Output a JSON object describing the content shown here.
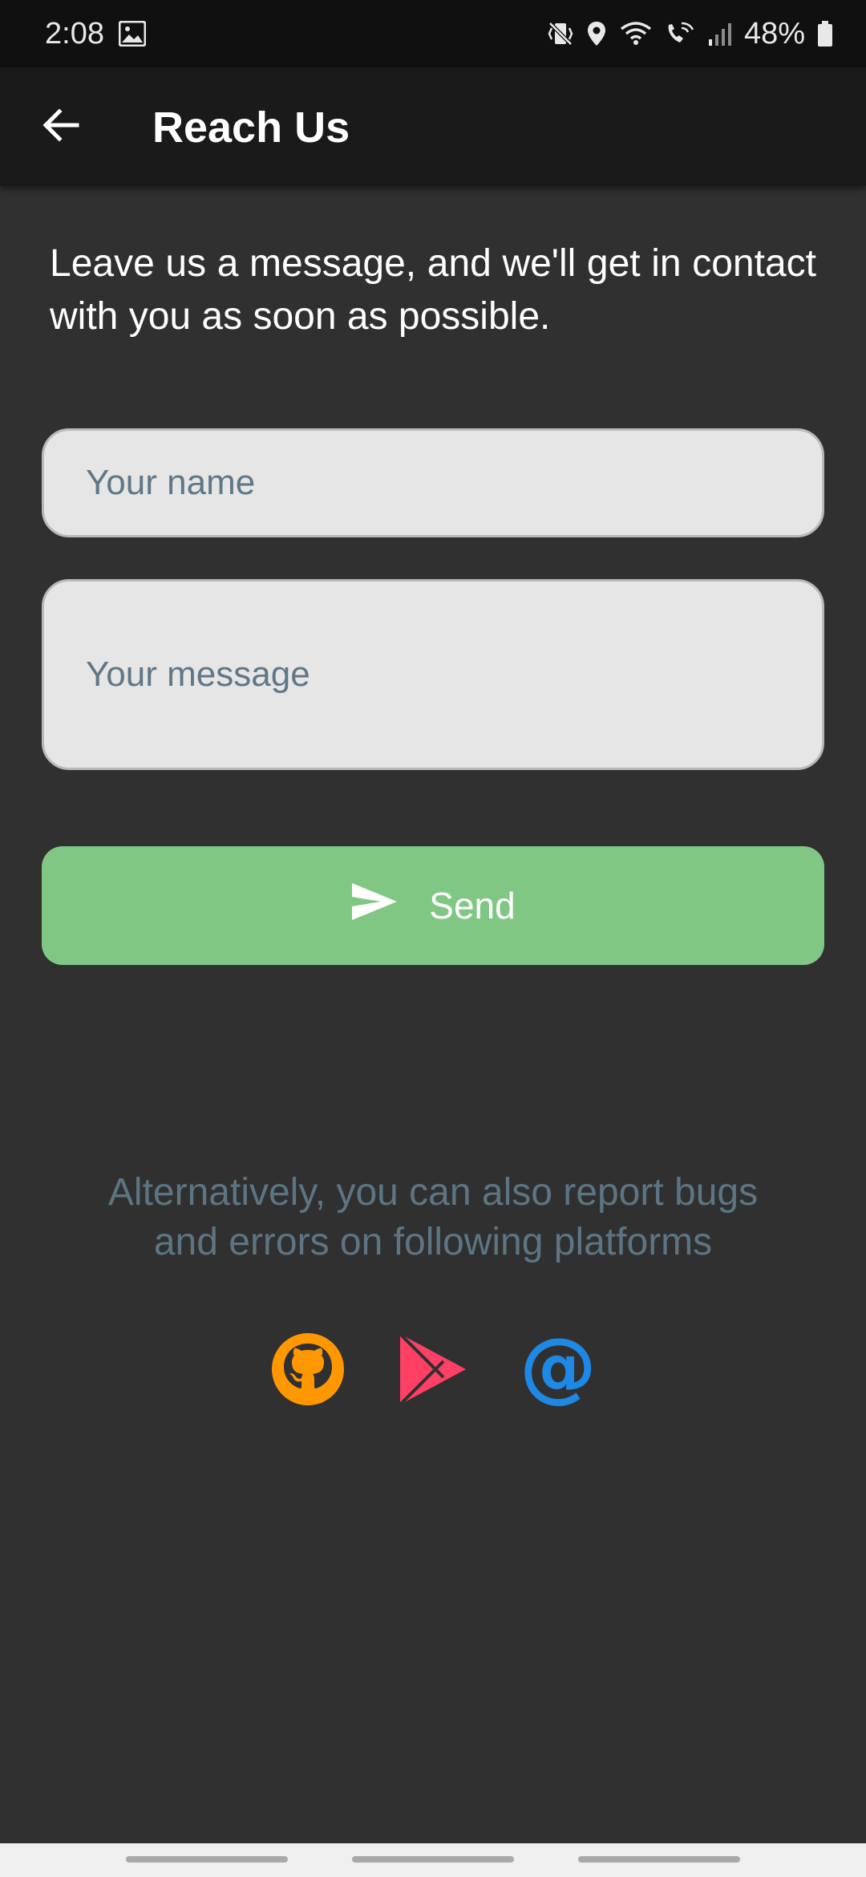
{
  "status_bar": {
    "time": "2:08",
    "battery_percent": "48%",
    "icons": [
      "gallery-icon",
      "vibrate-icon",
      "location-icon",
      "wifi-icon",
      "wifi-calling-icon",
      "signal-icon",
      "battery-icon"
    ]
  },
  "app_bar": {
    "title": "Reach Us",
    "back_icon": "arrow-left-icon"
  },
  "intro": {
    "text": "Leave us a message, and we'll get in contact with you as soon as possible."
  },
  "form": {
    "name_value": "",
    "name_placeholder": "Your name",
    "message_value": "",
    "message_placeholder": "Your message",
    "send_label": "Send",
    "send_icon": "send-icon"
  },
  "alternatives": {
    "text": "Alternatively, you can also report bugs and errors on following platforms",
    "platforms": [
      {
        "icon": "github-icon",
        "color": "#ff9800"
      },
      {
        "icon": "play-store-icon",
        "color": "#ff4064"
      },
      {
        "icon": "email-at-icon",
        "color": "#1e88e5"
      }
    ]
  },
  "colors": {
    "background": "#303030",
    "app_bar": "#1a1a1a",
    "accent_green": "#81c784",
    "muted_text": "#5d7583"
  }
}
